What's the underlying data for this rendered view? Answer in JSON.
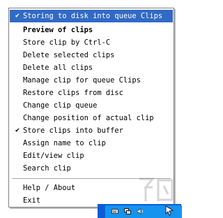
{
  "menu": {
    "items": [
      {
        "label": "Storing to disk into queue Clips",
        "checked": true,
        "highlighted": true,
        "bold": false
      },
      {
        "label": "Preview of clips",
        "checked": false,
        "highlighted": false,
        "bold": true
      },
      {
        "label": "Store clip by Ctrl-C",
        "checked": false,
        "highlighted": false,
        "bold": false
      },
      {
        "label": "Delete selected clips",
        "checked": false,
        "highlighted": false,
        "bold": false
      },
      {
        "label": "Delete all clips",
        "checked": false,
        "highlighted": false,
        "bold": false
      },
      {
        "label": "Manage clip for queue Clips",
        "checked": false,
        "highlighted": false,
        "bold": false
      },
      {
        "label": "Restore clips from disc",
        "checked": false,
        "highlighted": false,
        "bold": false
      },
      {
        "label": "Change clip queue",
        "checked": false,
        "highlighted": false,
        "bold": false
      },
      {
        "label": "Change position of actual clip",
        "checked": false,
        "highlighted": false,
        "bold": false
      },
      {
        "label": "Store clips into buffer",
        "checked": true,
        "highlighted": false,
        "bold": false
      },
      {
        "label": "Assign name to clip",
        "checked": false,
        "highlighted": false,
        "bold": false
      },
      {
        "label": "Edit/view clip",
        "checked": false,
        "highlighted": false,
        "bold": false
      },
      {
        "label": "Search clip",
        "checked": false,
        "highlighted": false,
        "bold": false
      },
      {
        "label": "Help / About",
        "checked": false,
        "highlighted": false,
        "bold": false
      },
      {
        "label": "Exit",
        "checked": false,
        "highlighted": false,
        "bold": false
      }
    ],
    "check_glyph": "✔"
  },
  "colors": {
    "highlight": "#316ac5",
    "taskbar": "#0a5bd6",
    "tray": "#1593ee"
  },
  "tray_icons": [
    "keyboard-icon",
    "network-icon",
    "speaker-icon",
    "clips-app-icon"
  ]
}
